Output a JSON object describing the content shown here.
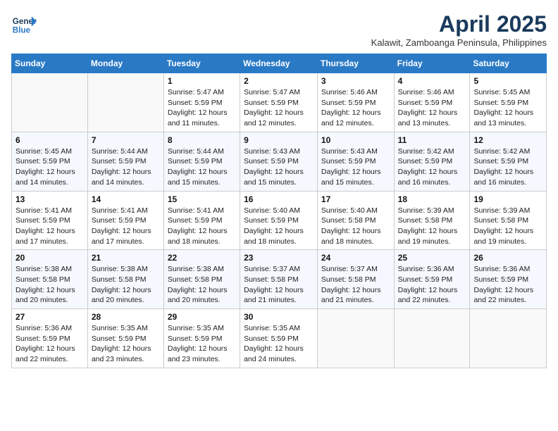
{
  "header": {
    "logo_line1": "General",
    "logo_line2": "Blue",
    "month_title": "April 2025",
    "subtitle": "Kalawit, Zamboanga Peninsula, Philippines"
  },
  "weekdays": [
    "Sunday",
    "Monday",
    "Tuesday",
    "Wednesday",
    "Thursday",
    "Friday",
    "Saturday"
  ],
  "weeks": [
    [
      {
        "day": "",
        "info": ""
      },
      {
        "day": "",
        "info": ""
      },
      {
        "day": "1",
        "info": "Sunrise: 5:47 AM\nSunset: 5:59 PM\nDaylight: 12 hours and 11 minutes."
      },
      {
        "day": "2",
        "info": "Sunrise: 5:47 AM\nSunset: 5:59 PM\nDaylight: 12 hours and 12 minutes."
      },
      {
        "day": "3",
        "info": "Sunrise: 5:46 AM\nSunset: 5:59 PM\nDaylight: 12 hours and 12 minutes."
      },
      {
        "day": "4",
        "info": "Sunrise: 5:46 AM\nSunset: 5:59 PM\nDaylight: 12 hours and 13 minutes."
      },
      {
        "day": "5",
        "info": "Sunrise: 5:45 AM\nSunset: 5:59 PM\nDaylight: 12 hours and 13 minutes."
      }
    ],
    [
      {
        "day": "6",
        "info": "Sunrise: 5:45 AM\nSunset: 5:59 PM\nDaylight: 12 hours and 14 minutes."
      },
      {
        "day": "7",
        "info": "Sunrise: 5:44 AM\nSunset: 5:59 PM\nDaylight: 12 hours and 14 minutes."
      },
      {
        "day": "8",
        "info": "Sunrise: 5:44 AM\nSunset: 5:59 PM\nDaylight: 12 hours and 15 minutes."
      },
      {
        "day": "9",
        "info": "Sunrise: 5:43 AM\nSunset: 5:59 PM\nDaylight: 12 hours and 15 minutes."
      },
      {
        "day": "10",
        "info": "Sunrise: 5:43 AM\nSunset: 5:59 PM\nDaylight: 12 hours and 15 minutes."
      },
      {
        "day": "11",
        "info": "Sunrise: 5:42 AM\nSunset: 5:59 PM\nDaylight: 12 hours and 16 minutes."
      },
      {
        "day": "12",
        "info": "Sunrise: 5:42 AM\nSunset: 5:59 PM\nDaylight: 12 hours and 16 minutes."
      }
    ],
    [
      {
        "day": "13",
        "info": "Sunrise: 5:41 AM\nSunset: 5:59 PM\nDaylight: 12 hours and 17 minutes."
      },
      {
        "day": "14",
        "info": "Sunrise: 5:41 AM\nSunset: 5:59 PM\nDaylight: 12 hours and 17 minutes."
      },
      {
        "day": "15",
        "info": "Sunrise: 5:41 AM\nSunset: 5:59 PM\nDaylight: 12 hours and 18 minutes."
      },
      {
        "day": "16",
        "info": "Sunrise: 5:40 AM\nSunset: 5:59 PM\nDaylight: 12 hours and 18 minutes."
      },
      {
        "day": "17",
        "info": "Sunrise: 5:40 AM\nSunset: 5:58 PM\nDaylight: 12 hours and 18 minutes."
      },
      {
        "day": "18",
        "info": "Sunrise: 5:39 AM\nSunset: 5:58 PM\nDaylight: 12 hours and 19 minutes."
      },
      {
        "day": "19",
        "info": "Sunrise: 5:39 AM\nSunset: 5:58 PM\nDaylight: 12 hours and 19 minutes."
      }
    ],
    [
      {
        "day": "20",
        "info": "Sunrise: 5:38 AM\nSunset: 5:58 PM\nDaylight: 12 hours and 20 minutes."
      },
      {
        "day": "21",
        "info": "Sunrise: 5:38 AM\nSunset: 5:58 PM\nDaylight: 12 hours and 20 minutes."
      },
      {
        "day": "22",
        "info": "Sunrise: 5:38 AM\nSunset: 5:58 PM\nDaylight: 12 hours and 20 minutes."
      },
      {
        "day": "23",
        "info": "Sunrise: 5:37 AM\nSunset: 5:58 PM\nDaylight: 12 hours and 21 minutes."
      },
      {
        "day": "24",
        "info": "Sunrise: 5:37 AM\nSunset: 5:58 PM\nDaylight: 12 hours and 21 minutes."
      },
      {
        "day": "25",
        "info": "Sunrise: 5:36 AM\nSunset: 5:59 PM\nDaylight: 12 hours and 22 minutes."
      },
      {
        "day": "26",
        "info": "Sunrise: 5:36 AM\nSunset: 5:59 PM\nDaylight: 12 hours and 22 minutes."
      }
    ],
    [
      {
        "day": "27",
        "info": "Sunrise: 5:36 AM\nSunset: 5:59 PM\nDaylight: 12 hours and 22 minutes."
      },
      {
        "day": "28",
        "info": "Sunrise: 5:35 AM\nSunset: 5:59 PM\nDaylight: 12 hours and 23 minutes."
      },
      {
        "day": "29",
        "info": "Sunrise: 5:35 AM\nSunset: 5:59 PM\nDaylight: 12 hours and 23 minutes."
      },
      {
        "day": "30",
        "info": "Sunrise: 5:35 AM\nSunset: 5:59 PM\nDaylight: 12 hours and 24 minutes."
      },
      {
        "day": "",
        "info": ""
      },
      {
        "day": "",
        "info": ""
      },
      {
        "day": "",
        "info": ""
      }
    ]
  ]
}
